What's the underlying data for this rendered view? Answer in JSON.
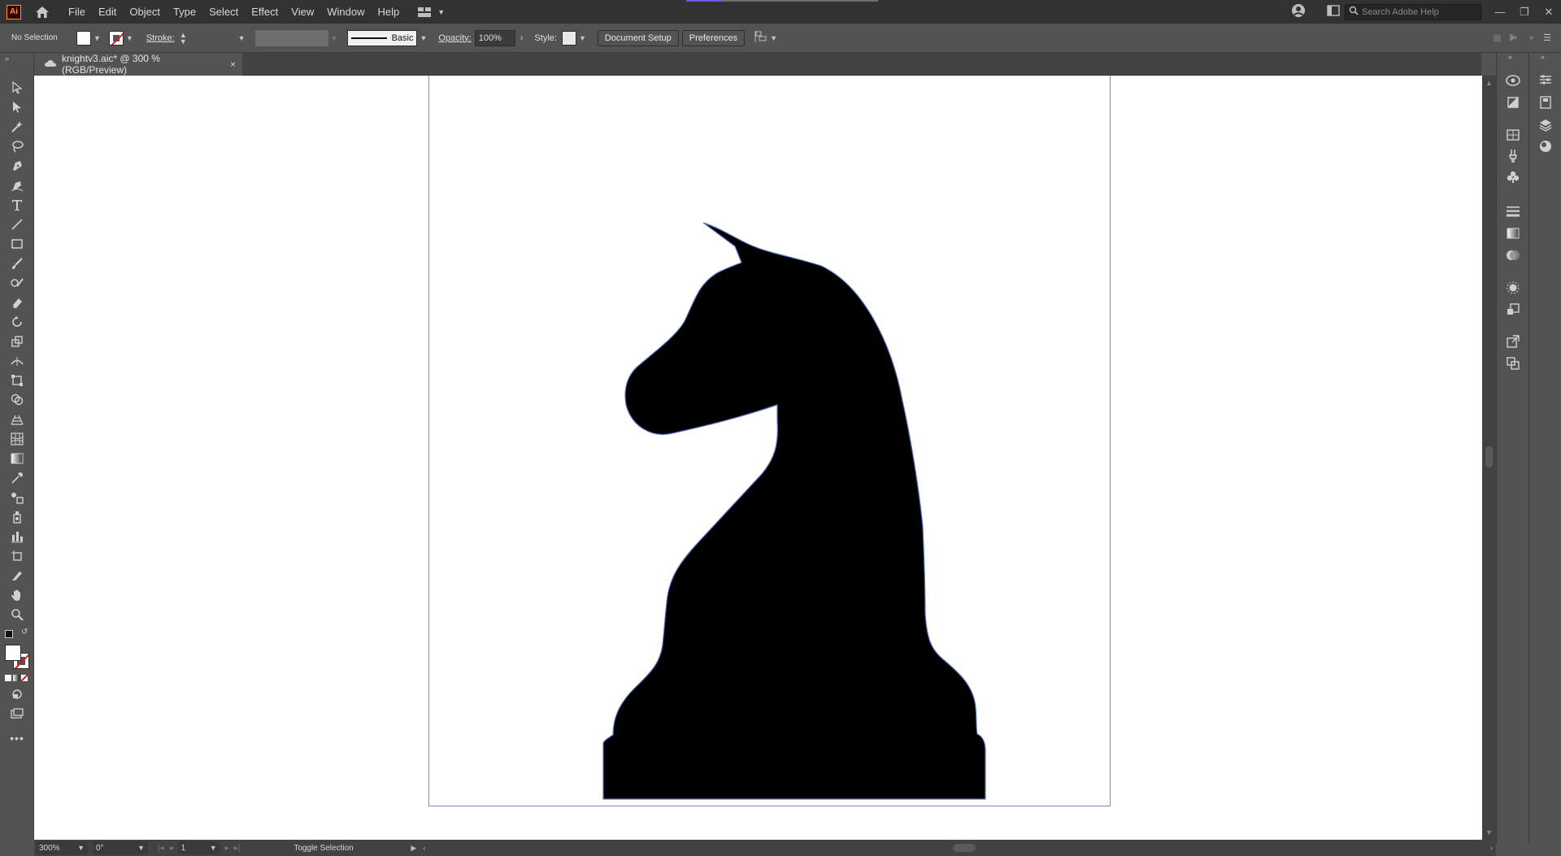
{
  "app": {
    "logo_text": "Ai"
  },
  "menu": [
    "File",
    "Edit",
    "Object",
    "Type",
    "Select",
    "Effect",
    "View",
    "Window",
    "Help"
  ],
  "search": {
    "placeholder": "Search Adobe Help"
  },
  "window_controls": {
    "minimize": "—",
    "restore": "❐",
    "close": "✕"
  },
  "control_bar": {
    "selection_status": "No Selection",
    "stroke_label": "Stroke:",
    "brush_label": "Basic",
    "opacity_label": "Opacity:",
    "opacity_value": "100%",
    "style_label": "Style:",
    "document_setup": "Document Setup",
    "preferences": "Preferences"
  },
  "document_tab": {
    "title": "knightv3.aic* @ 300 % (RGB/Preview)",
    "close": "×"
  },
  "status_bar": {
    "zoom": "300%",
    "rotation": "0°",
    "artboard_number": "1",
    "status_text": "Toggle Selection"
  },
  "colors": {
    "fill": "#ffffff",
    "stroke": "none",
    "artwork_fill": "#000000",
    "artboard_border": "#6a8ee8",
    "ui_background": "#535353"
  },
  "tools": [
    "selection-tool",
    "direct-selection-tool",
    "magic-wand-tool",
    "lasso-tool",
    "pen-tool",
    "curvature-tool",
    "type-tool",
    "line-segment-tool",
    "rectangle-tool",
    "paintbrush-tool",
    "shaper-tool",
    "eraser-tool",
    "rotate-tool",
    "scale-tool",
    "width-tool",
    "free-transform-tool",
    "shape-builder-tool",
    "perspective-grid-tool",
    "mesh-tool",
    "gradient-tool",
    "eyedropper-tool",
    "blend-tool",
    "symbol-sprayer-tool",
    "column-graph-tool",
    "artboard-tool",
    "slice-tool",
    "hand-tool",
    "zoom-tool"
  ]
}
